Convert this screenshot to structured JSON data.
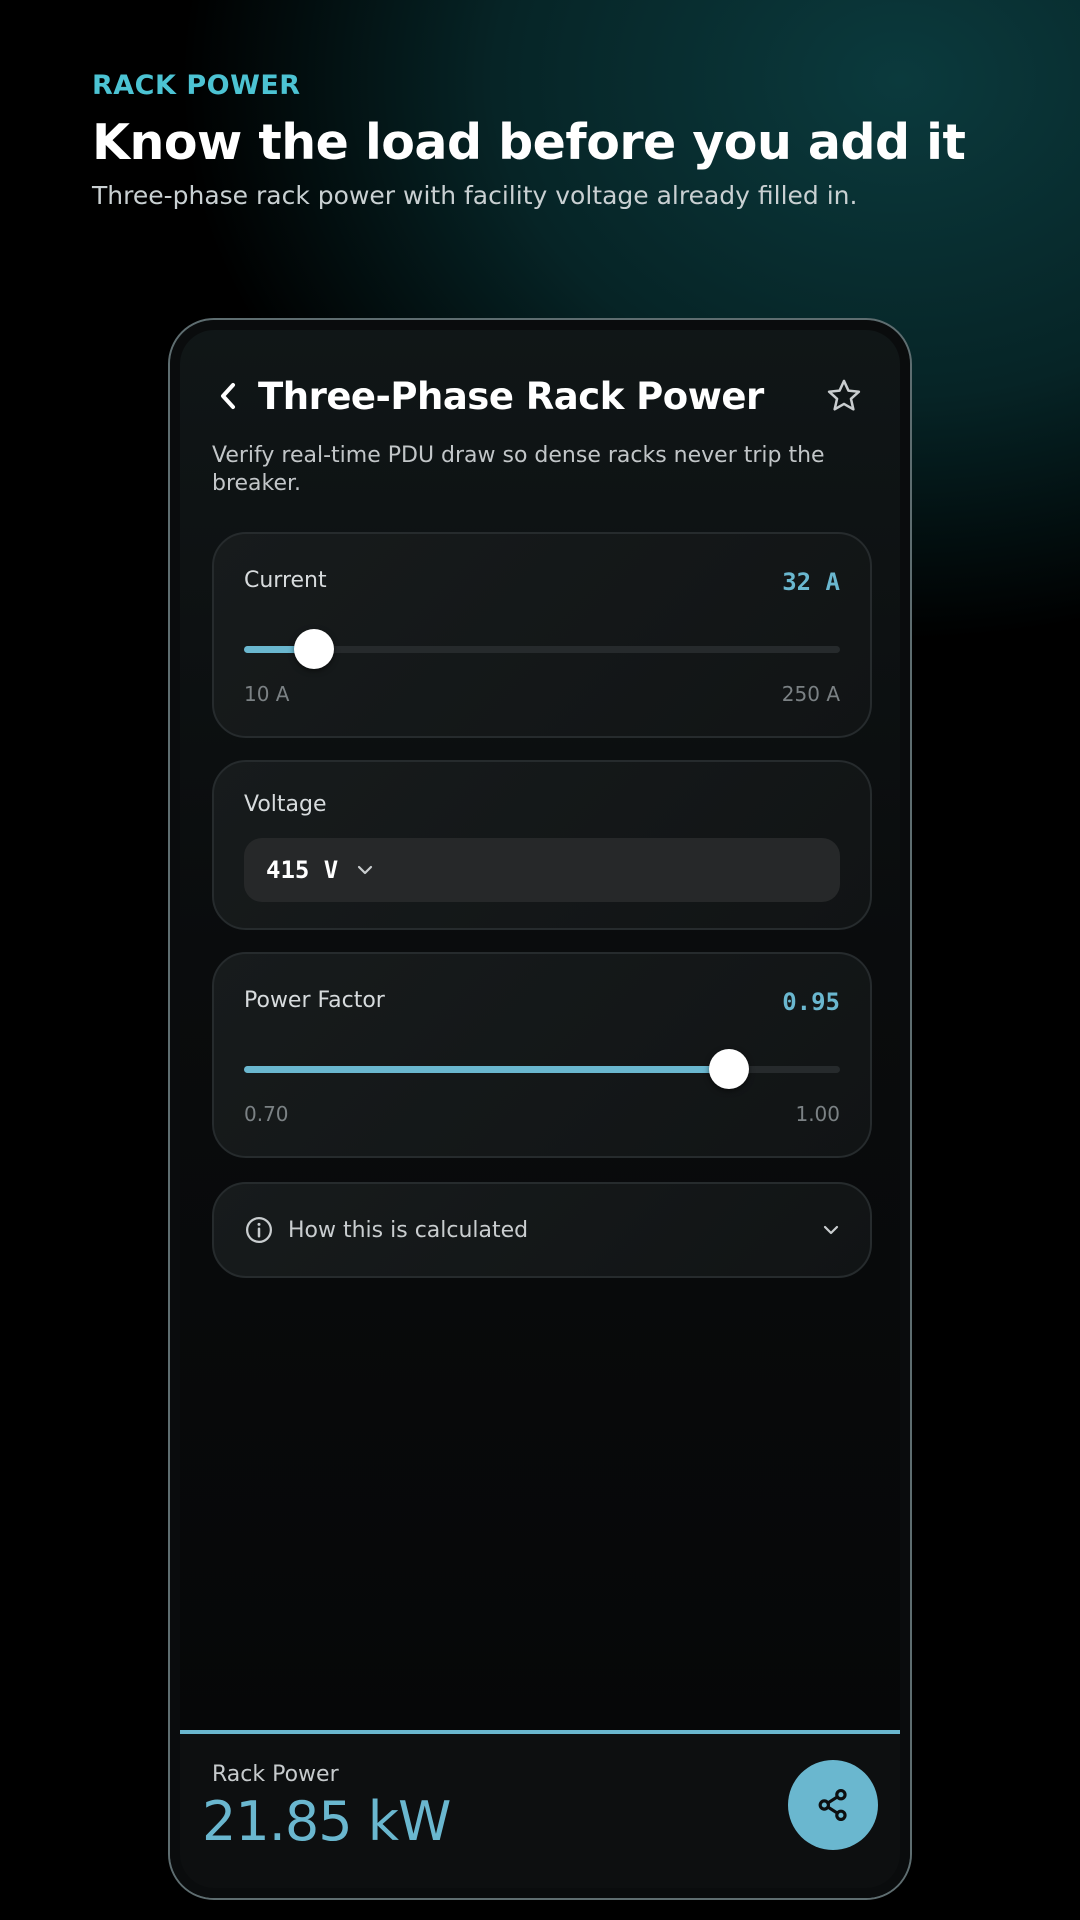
{
  "hero": {
    "eyebrow": "RACK POWER",
    "headline": "Know the load before you add it",
    "subline": "Three-phase rack power with facility voltage already filled in."
  },
  "screen": {
    "title": "Three-Phase Rack Power",
    "description": "Verify real-time PDU draw so dense racks never trip the breaker.",
    "current": {
      "label": "Current",
      "value": "32 A",
      "min": "10 A",
      "max": "250 A",
      "fill_fraction": 0.117
    },
    "voltage": {
      "label": "Voltage",
      "selected": "415 V"
    },
    "power_factor": {
      "label": "Power Factor",
      "value": "0.95",
      "min": "0.70",
      "max": "1.00",
      "fill_fraction": 0.813
    },
    "how_calculated": {
      "label": "How this is calculated"
    },
    "result": {
      "label": "Rack Power",
      "value": "21.85 kW"
    }
  },
  "colors": {
    "accent": "#6ab7cf",
    "eyebrow": "#4cc3d3"
  }
}
